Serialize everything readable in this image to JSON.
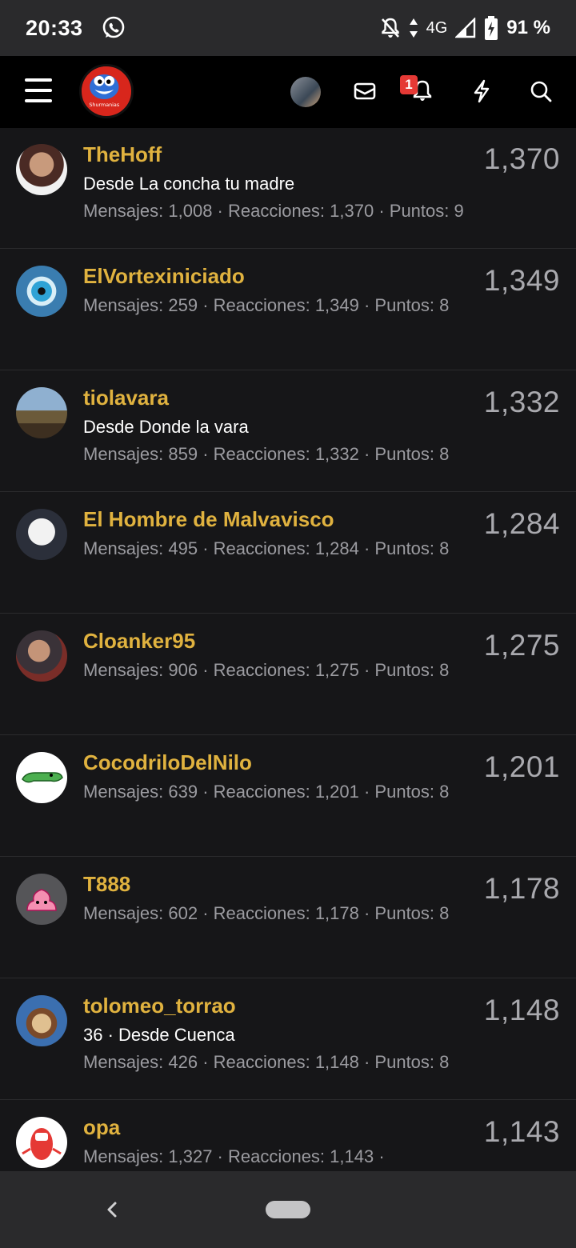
{
  "status_bar": {
    "time": "20:33",
    "network": "4G",
    "battery": "91 %"
  },
  "header": {
    "logo_text": "Shurmanias",
    "notification_count": "1"
  },
  "members": [
    {
      "name": "TheHoff",
      "location": "Desde La concha tu madre",
      "stats": "Mensajes: 1,008 · Reacciones: 1,370 · Puntos: 9",
      "score": "1,370"
    },
    {
      "name": "ElVortexiniciado",
      "location": "",
      "stats": "Mensajes: 259 · Reacciones: 1,349 · Puntos: 8",
      "score": "1,349"
    },
    {
      "name": "tiolavara",
      "location": "Desde Donde la vara",
      "stats": "Mensajes: 859 · Reacciones: 1,332 · Puntos: 8",
      "score": "1,332"
    },
    {
      "name": "El Hombre de Malvavisco",
      "location": "",
      "stats": "Mensajes: 495 · Reacciones: 1,284 · Puntos: 8",
      "score": "1,284"
    },
    {
      "name": "Cloanker95",
      "location": "",
      "stats": "Mensajes: 906 · Reacciones: 1,275 · Puntos: 8",
      "score": "1,275"
    },
    {
      "name": "CocodriloDelNilo",
      "location": "",
      "stats": "Mensajes: 639 · Reacciones: 1,201 · Puntos: 8",
      "score": "1,201"
    },
    {
      "name": "T888",
      "location": "",
      "stats": "Mensajes: 602 · Reacciones: 1,178 · Puntos: 8",
      "score": "1,178"
    },
    {
      "name": "tolomeo_torrao",
      "location": "36 · Desde Cuenca",
      "stats": "Mensajes: 426 · Reacciones: 1,148 · Puntos: 8",
      "score": "1,148"
    },
    {
      "name": "opa",
      "location": "",
      "stats": "Mensajes: 1,327 · Reacciones: 1,143 ·",
      "score": "1,143"
    }
  ],
  "colors": {
    "username": "#e0b23f",
    "background": "#161618",
    "header": "#000000",
    "badge": "#e53935"
  }
}
